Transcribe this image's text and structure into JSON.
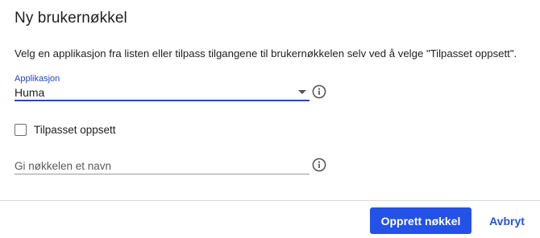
{
  "dialog": {
    "title": "Ny brukernøkkel",
    "description": "Velg en applikasjon fra listen eller tilpass tilgangene til brukernøkkelen selv ved å velge \"Tilpasset oppsett\"."
  },
  "application_select": {
    "label": "Applikasjon",
    "value": "Huma",
    "icon": "chevron-down-icon"
  },
  "custom_setup": {
    "label": "Tilpasset oppsett",
    "checked": false
  },
  "name_field": {
    "placeholder": "Gi nøkkelen et navn",
    "value": ""
  },
  "info_icon": "info-icon",
  "buttons": {
    "create_label": "Opprett nøkkel",
    "cancel_label": "Avbryt"
  },
  "colors": {
    "accent": "#2452e8",
    "label_accent": "#2244d6"
  }
}
